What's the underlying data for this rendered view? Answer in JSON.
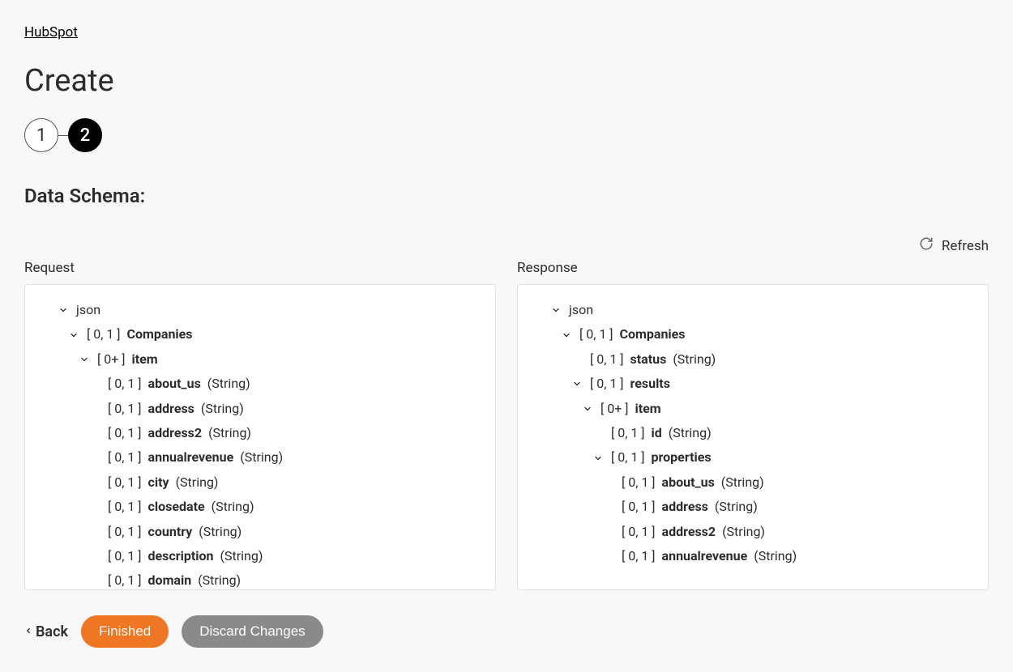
{
  "breadcrumb": {
    "link": "HubSpot"
  },
  "page_title": "Create",
  "stepper": {
    "step1": "1",
    "step2": "2"
  },
  "section_title": "Data Schema:",
  "refresh_label": "Refresh",
  "columns": {
    "request": {
      "title": "Request",
      "tree": [
        {
          "indent": 3,
          "expanded": true,
          "card": "",
          "name": "json",
          "type": ""
        },
        {
          "indent": 4,
          "expanded": true,
          "card": "[ 0, 1 ]",
          "name": "Companies",
          "type": ""
        },
        {
          "indent": 5,
          "expanded": true,
          "card": "[ 0+ ]",
          "name": "item",
          "type": ""
        },
        {
          "indent": 6,
          "expanded": null,
          "card": "[ 0, 1 ]",
          "name": "about_us",
          "type": "(String)"
        },
        {
          "indent": 6,
          "expanded": null,
          "card": "[ 0, 1 ]",
          "name": "address",
          "type": "(String)"
        },
        {
          "indent": 6,
          "expanded": null,
          "card": "[ 0, 1 ]",
          "name": "address2",
          "type": "(String)"
        },
        {
          "indent": 6,
          "expanded": null,
          "card": "[ 0, 1 ]",
          "name": "annualrevenue",
          "type": "(String)"
        },
        {
          "indent": 6,
          "expanded": null,
          "card": "[ 0, 1 ]",
          "name": "city",
          "type": "(String)"
        },
        {
          "indent": 6,
          "expanded": null,
          "card": "[ 0, 1 ]",
          "name": "closedate",
          "type": "(String)"
        },
        {
          "indent": 6,
          "expanded": null,
          "card": "[ 0, 1 ]",
          "name": "country",
          "type": "(String)"
        },
        {
          "indent": 6,
          "expanded": null,
          "card": "[ 0, 1 ]",
          "name": "description",
          "type": "(String)"
        },
        {
          "indent": 6,
          "expanded": null,
          "card": "[ 0, 1 ]",
          "name": "domain",
          "type": "(String)"
        }
      ]
    },
    "response": {
      "title": "Response",
      "tree": [
        {
          "indent": 3,
          "expanded": true,
          "card": "",
          "name": "json",
          "type": ""
        },
        {
          "indent": 4,
          "expanded": true,
          "card": "[ 0, 1 ]",
          "name": "Companies",
          "type": ""
        },
        {
          "indent": 5,
          "expanded": null,
          "card": "[ 0, 1 ]",
          "name": "status",
          "type": "(String)"
        },
        {
          "indent": 5,
          "expanded": true,
          "card": "[ 0, 1 ]",
          "name": "results",
          "type": ""
        },
        {
          "indent": 6,
          "expanded": true,
          "card": "[ 0+ ]",
          "name": "item",
          "type": ""
        },
        {
          "indent": 7,
          "expanded": null,
          "card": "[ 0, 1 ]",
          "name": "id",
          "type": "(String)"
        },
        {
          "indent": 7,
          "expanded": true,
          "card": "[ 0, 1 ]",
          "name": "properties",
          "type": ""
        },
        {
          "indent": 8,
          "expanded": null,
          "card": "[ 0, 1 ]",
          "name": "about_us",
          "type": "(String)"
        },
        {
          "indent": 8,
          "expanded": null,
          "card": "[ 0, 1 ]",
          "name": "address",
          "type": "(String)"
        },
        {
          "indent": 8,
          "expanded": null,
          "card": "[ 0, 1 ]",
          "name": "address2",
          "type": "(String)"
        },
        {
          "indent": 8,
          "expanded": null,
          "card": "[ 0, 1 ]",
          "name": "annualrevenue",
          "type": "(String)"
        }
      ]
    }
  },
  "footer": {
    "back": "Back",
    "finished": "Finished",
    "discard": "Discard Changes"
  }
}
